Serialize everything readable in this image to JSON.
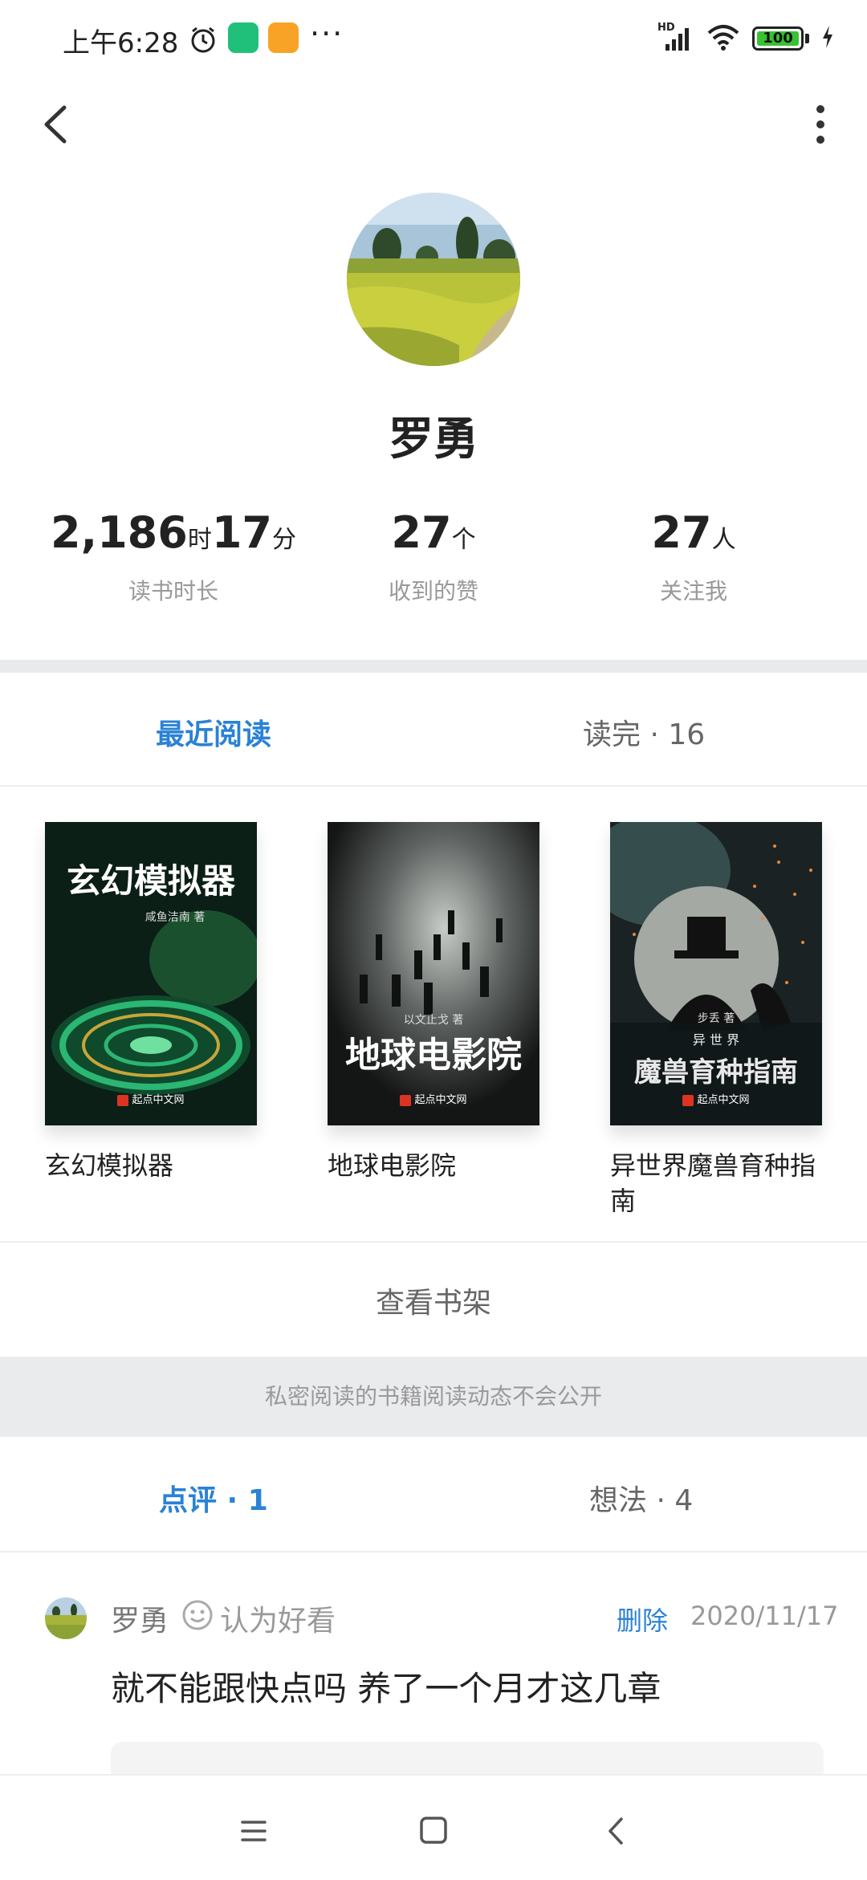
{
  "status_bar": {
    "time": "上午6:28",
    "dots": "···",
    "network": "HD",
    "battery": "100",
    "app_icon_colors": [
      "#20c07a",
      "#f8a325"
    ]
  },
  "header": {
    "back_icon": "chevron-left-icon",
    "more_icon": "more-vertical-icon"
  },
  "profile": {
    "name": "罗勇",
    "stats": [
      {
        "parts": [
          {
            "value": "2,186",
            "unit": "时"
          },
          {
            "value": "17",
            "unit": "分"
          }
        ],
        "label": "读书时长"
      },
      {
        "parts": [
          {
            "value": "27",
            "unit": "个"
          }
        ],
        "label": "收到的赞"
      },
      {
        "parts": [
          {
            "value": "27",
            "unit": "人"
          }
        ],
        "label": "关注我"
      }
    ]
  },
  "reading_tabs": {
    "recent": "最近阅读",
    "finished": "读完 · 16"
  },
  "books": [
    {
      "title": "玄幻模拟器",
      "cover_title": "玄幻模拟器",
      "cover_author": "咸鱼洁南 著",
      "publisher": "起点中文网",
      "cover_color": "#0d2a1c",
      "accent": "#2bb673"
    },
    {
      "title": "地球电影院",
      "cover_title": "地球电影院",
      "cover_author": "以文止戈 著",
      "publisher": "起点中文网",
      "cover_color": "#1e1f1f",
      "accent": "#b9c0c0"
    },
    {
      "title": "异世界魔兽育种指南",
      "cover_title": "魔兽育种指南",
      "cover_subtitle": "异 世 界",
      "cover_author": "步丢 著",
      "publisher": "起点中文网",
      "cover_color": "#1c2628",
      "accent": "#d87a3a"
    }
  ],
  "shelf_link": "查看书架",
  "private_note": "私密阅读的书籍阅读动态不会公开",
  "content_tabs": {
    "reviews": "点评 · 1",
    "thoughts": "想法 · 4"
  },
  "review": {
    "author": "罗勇",
    "verdict": "认为好看",
    "delete_label": "删除",
    "date": "2020/11/17",
    "text": "就不能跟快点吗  养了一个月才这几章"
  },
  "nav": {
    "menu_icon": "menu-icon",
    "home_icon": "home-square-icon",
    "back_icon": "nav-back-icon"
  },
  "colors": {
    "accent": "#2a82d4",
    "separator": "#e9eaec"
  }
}
